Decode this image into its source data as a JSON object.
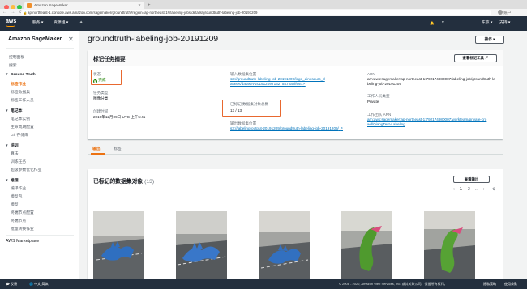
{
  "browser": {
    "tab_title": "Amazon SageMaker",
    "url": "ap-northeast-1.console.aws.amazon.com/sagemaker/groundtruth?region=ap-northeast-1#/labeling-jobs/details/groundtruth-labeling-job-20191209",
    "account": "账户"
  },
  "topnav": {
    "logo": "aws",
    "services": "服务 ▾",
    "resource_groups": "资源组 ▾",
    "pin": "✦",
    "bell": "🔔",
    "account": "▼ ",
    "region": "东京 ▾",
    "support": "支持 ▾"
  },
  "sidebar": {
    "title": "Amazon SageMaker",
    "close": "✕",
    "items": {
      "dashboard": "控制面板",
      "search": "搜索",
      "ground_truth": "Ground Truth",
      "labeling_jobs": "标签作业",
      "labeling_datasets": "标签数据集",
      "labeling_workforces": "标签工作人员",
      "notebook": "笔记本",
      "notebook_instances": "笔记本实例",
      "lifecycle_configs": "生命周期配置",
      "git_repos": "Git 存储库",
      "training": "培训",
      "algorithms": "算法",
      "training_jobs": "训练任务",
      "hyperparameter": "超级参数优化作业",
      "inference": "推理",
      "compile_jobs": "编译作业",
      "model_packages": "模型包",
      "models": "模型",
      "endpoint_configs": "终端节点配置",
      "endpoints": "终端节点",
      "batch_transform": "批量转换作业",
      "marketplace": "AWS Marketplace"
    }
  },
  "main": {
    "job_title": "groundtruth-labeling-job-20191209",
    "actions_button": "操作 ▾",
    "summary": {
      "title": "标记任务摘要",
      "view_tool_button": "查看标记工具 ↗",
      "status_label": "状态",
      "status_value": "完成",
      "task_type_label": "任务类型",
      "task_type_value": "图像分类",
      "created_label": "创建时间",
      "created_value": "2019年12月09日 UTC 上午5:41",
      "input_label": "输入数据集位置",
      "input_value": "s3://groundtruth-labeling-job-20191209/lego_dinosaurs_dataset/dataset-20191209T132754.manifest",
      "labeled_label": "已标记/数据集对象总数",
      "labeled_value": "13 / 13",
      "output_label": "输出数据集位置",
      "output_value": "s3://labeling-output-20191209/groundtruth-labeling-job-20191209/",
      "arn_label": "ARN",
      "arn_value": "arn:aws:sagemaker:ap-northeast-1:792174980007:labeling-job/groundtruth-labeling-job-20191209",
      "worker_type_label": "工作人员类型",
      "worker_type_value": "Private",
      "workteam_label": "工作团队 ARN",
      "workteam_value": "arn:aws:sagemaker:ap-northeast-1:792174980007:workteam/private-crowd/QiangTest-Labeling",
      "ext_icon": "↗"
    },
    "tabs": [
      "输出",
      "标签"
    ],
    "dataset": {
      "title": "已标记的数据集对象",
      "count": "(13)",
      "view_output_button": "查看输出",
      "pager_prev": "‹",
      "pages": [
        "1",
        "2"
      ],
      "pager_ellipsis": "...",
      "pager_next": "›",
      "settings_icon": "⚙"
    }
  },
  "footer": {
    "feedback": "反馈",
    "language": "中文(简体)",
    "copyright": "© 2008 - 2020, Amazon Web Services, Inc. 或其关联公司。保留所有权利。",
    "privacy": "隐私策略",
    "terms": "使用条款"
  },
  "colors": {
    "accent": "#ec7211",
    "nav_bg": "#232f3e",
    "link": "#0073bb",
    "success": "#1d8102",
    "highlight": "#e8682f"
  }
}
